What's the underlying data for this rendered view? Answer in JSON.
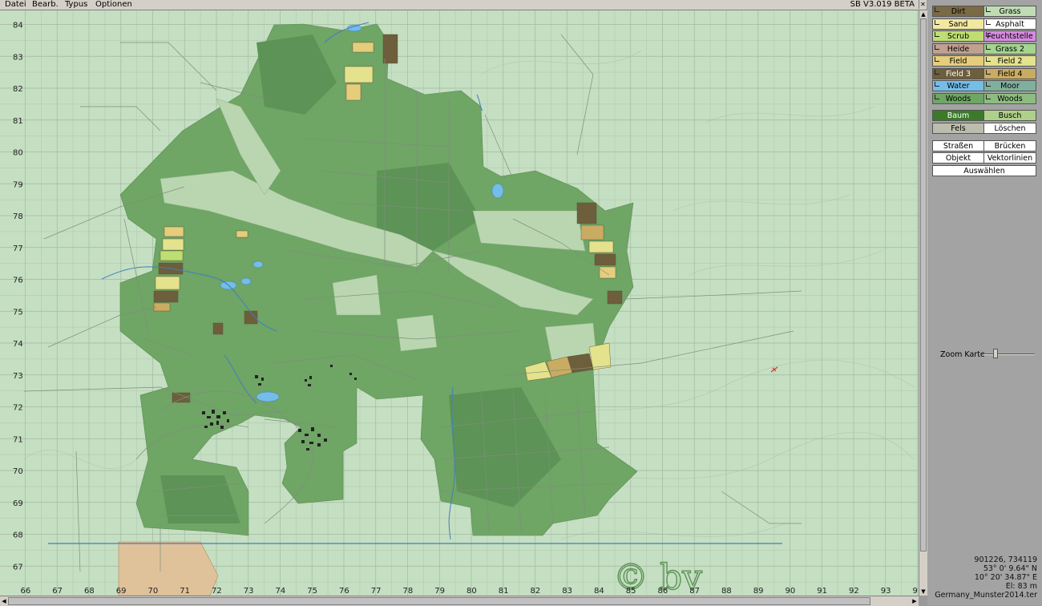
{
  "menubar": {
    "items": [
      "Datei",
      "Bearb.",
      "Typus",
      "Optionen"
    ],
    "version": "SB V3.019 BETA"
  },
  "map": {
    "y_ticks": [
      "84",
      "83",
      "82",
      "81",
      "80",
      "79",
      "78",
      "77",
      "76",
      "75",
      "74",
      "73",
      "72",
      "71",
      "70",
      "69",
      "68",
      "67"
    ],
    "x_ticks": [
      "66",
      "67",
      "68",
      "69",
      "70",
      "71",
      "72",
      "73",
      "74",
      "75",
      "76",
      "77",
      "78",
      "79",
      "80",
      "81",
      "82",
      "83",
      "84",
      "85",
      "86",
      "87",
      "88",
      "89",
      "90",
      "91",
      "92",
      "93",
      "9"
    ],
    "watermark": "© bv",
    "colors": {
      "background": "#c5dfc2",
      "woods": "#6fa565",
      "woods_dark": "#5d9356",
      "grid": "#a3b8a1",
      "water": "#3f7fc0"
    }
  },
  "terrain": {
    "rows": [
      {
        "left": {
          "label": "Dirt",
          "color": "#7a6a45"
        },
        "right": {
          "label": "Grass",
          "color": "#c0dcb5"
        }
      },
      {
        "left": {
          "label": "Sand",
          "color": "#f2e8a0"
        },
        "right": {
          "label": "Asphalt",
          "color": "#ffffff"
        }
      },
      {
        "left": {
          "label": "Scrub",
          "color": "#bede72"
        },
        "right": {
          "label": "Feuchtstelle",
          "color": "#d68ce0"
        }
      },
      {
        "left": {
          "label": "Heide",
          "color": "#c0a090"
        },
        "right": {
          "label": "Grass 2",
          "color": "#a4d48f"
        }
      },
      {
        "left": {
          "label": "Field",
          "color": "#e6cd7b"
        },
        "right": {
          "label": "Field 2",
          "color": "#e4e28c"
        }
      },
      {
        "left": {
          "label": "Field 3",
          "color": "#6d5e3c"
        },
        "right": {
          "label": "Field 4",
          "color": "#c9ab62"
        }
      },
      {
        "left": {
          "label": "Water",
          "color": "#74bde8"
        },
        "right": {
          "label": "Moor",
          "color": "#7fb09c"
        }
      },
      {
        "left": {
          "label": "Woods",
          "color": "#6fa565"
        },
        "right": {
          "label": "Woods",
          "color": "#8dbc80"
        }
      }
    ]
  },
  "objects": {
    "rows": [
      {
        "left": {
          "label": "Baum",
          "color": "#3c7a2a"
        },
        "right": {
          "label": "Busch",
          "color": "#aed08a"
        }
      },
      {
        "left": {
          "label": "Fels",
          "color": "#bdbdae"
        },
        "right": {
          "label": "Löschen",
          "color": "#ffffff"
        }
      }
    ]
  },
  "tools": {
    "rows": [
      {
        "left": "Straßen",
        "right": "Brücken"
      },
      {
        "left": "Objekt",
        "right": "Vektorlinien"
      }
    ],
    "select": "Auswählen"
  },
  "zoom": {
    "label": "Zoom Karte",
    "level": 0.2
  },
  "status": {
    "coords": "901226, 734119",
    "lat": "53° 0' 9.64\" N",
    "lon": "10° 20' 34.87\" E",
    "elevation": "El: 83 m",
    "file": "Germany_Munster2014.ter"
  }
}
